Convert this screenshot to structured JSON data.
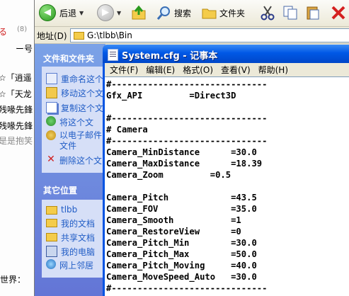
{
  "background_page": {
    "lines": [
      {
        "text": "る",
        "class": "bg-red"
      },
      {
        "text": "(8)",
        "class": "bg-gray"
      },
      {
        "text": "ー号",
        "class": ""
      },
      {
        "text": "☆「逍遥",
        "class": ""
      },
      {
        "text": "☆「天龙",
        "class": ""
      },
      {
        "text": "残喙先鋒",
        "class": ""
      },
      {
        "text": "残喙先鋒",
        "class": ""
      },
      {
        "text": "是是抱笑",
        "class": "bg-gray"
      },
      {
        "text": "世界：",
        "class": ""
      }
    ]
  },
  "toolbar": {
    "back_label": "后退",
    "search_label": "搜索",
    "folders_label": "文件夹",
    "cut_icon": "scissors-icon",
    "copy_icon": "copy-icon",
    "paste_icon": "paste-icon",
    "delete_icon": "delete-x-icon"
  },
  "address_bar": {
    "label": "地址(D)",
    "path": "G:\\tlbb\\Bin"
  },
  "task_pane": {
    "file_tasks_header": "文件和文件夹",
    "file_tasks": [
      {
        "label": "重命名这个",
        "icon": "rename"
      },
      {
        "label": "移动这个文",
        "icon": "move"
      },
      {
        "label": "复制这个文",
        "icon": "copy"
      },
      {
        "label": "将这个文",
        "icon": "web"
      },
      {
        "label": "以电子邮件",
        "icon": "mail",
        "second_line": "文件"
      },
      {
        "label": "删除这个文",
        "icon": "delete"
      }
    ],
    "other_places_header": "其它位置",
    "other_places": [
      {
        "label": "tlbb",
        "icon": "fold"
      },
      {
        "label": "我的文档",
        "icon": "docs"
      },
      {
        "label": "共享文档",
        "icon": "docs"
      },
      {
        "label": "我的电脑",
        "icon": "pc"
      },
      {
        "label": "网上邻居",
        "icon": "net"
      }
    ]
  },
  "notepad": {
    "title": "System.cfg - 记事本",
    "menus": [
      "文件(F)",
      "编辑(E)",
      "格式(O)",
      "查看(V)",
      "帮助(H)"
    ],
    "content": "#------------------------------\nGfx_API         =Direct3D\n\n#------------------------------\n# Camera\n#------------------------------\nCamera_MinDistance      =30.0\nCamera_MaxDistance      =18.39\nCamera_Zoom         =0.5\n\nCamera_Pitch            =43.5\nCamera_FOV              =35.0\nCamera_Smooth           =1\nCamera_RestoreView      =0\nCamera_Pitch_Min        =30.0\nCamera_Pitch_Max        =50.0\nCamera_Pitch_Moving     =40.0\nCamera_MoveSpeed_Auto   =30.0\n#------------------------------"
  }
}
